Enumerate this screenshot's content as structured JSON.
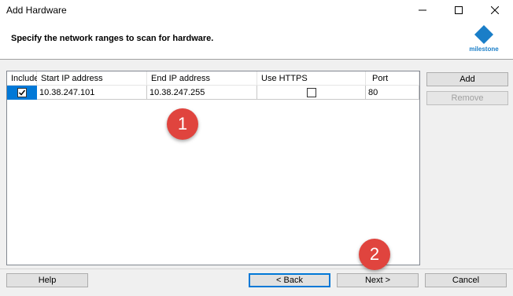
{
  "window": {
    "title": "Add Hardware",
    "minimize_icon": "minimize-icon",
    "maximize_icon": "maximize-icon",
    "close_icon": "close-icon"
  },
  "header": {
    "instruction": "Specify the network ranges to scan for hardware.",
    "logo_text": "milestone",
    "logo_color": "#1a7ec8"
  },
  "table": {
    "columns": [
      "Include",
      "Start IP address",
      "End IP address",
      "Use HTTPS",
      "Port"
    ],
    "rows": [
      {
        "include": true,
        "start_ip": "10.38.247.101",
        "end_ip": "10.38.247.255",
        "use_https": false,
        "port": "80"
      }
    ]
  },
  "side_buttons": {
    "add_label": "Add",
    "remove_label": "Remove"
  },
  "footer": {
    "help_label": "Help",
    "back_label": "< Back",
    "next_label": "Next >",
    "cancel_label": "Cancel"
  },
  "annotations": {
    "badge1": "1",
    "badge2": "2",
    "badge_color": "#e0443e"
  },
  "accent_color": "#0078d7"
}
